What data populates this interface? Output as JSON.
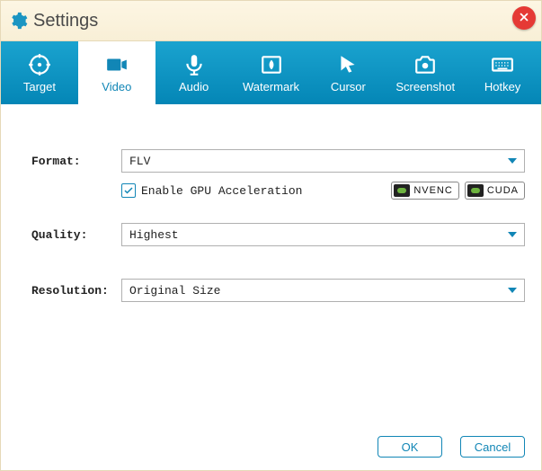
{
  "window": {
    "title": "Settings"
  },
  "tabs": {
    "target": "Target",
    "video": "Video",
    "audio": "Audio",
    "watermark": "Watermark",
    "cursor": "Cursor",
    "screenshot": "Screenshot",
    "hotkey": "Hotkey",
    "active": "video"
  },
  "video": {
    "format_label": "Format:",
    "format_value": "FLV",
    "gpu_checked": true,
    "gpu_label": "Enable GPU Acceleration",
    "badge_nvenc": "NVENC",
    "badge_cuda": "CUDA",
    "quality_label": "Quality:",
    "quality_value": "Highest",
    "resolution_label": "Resolution:",
    "resolution_value": "Original Size"
  },
  "buttons": {
    "ok": "OK",
    "cancel": "Cancel"
  }
}
